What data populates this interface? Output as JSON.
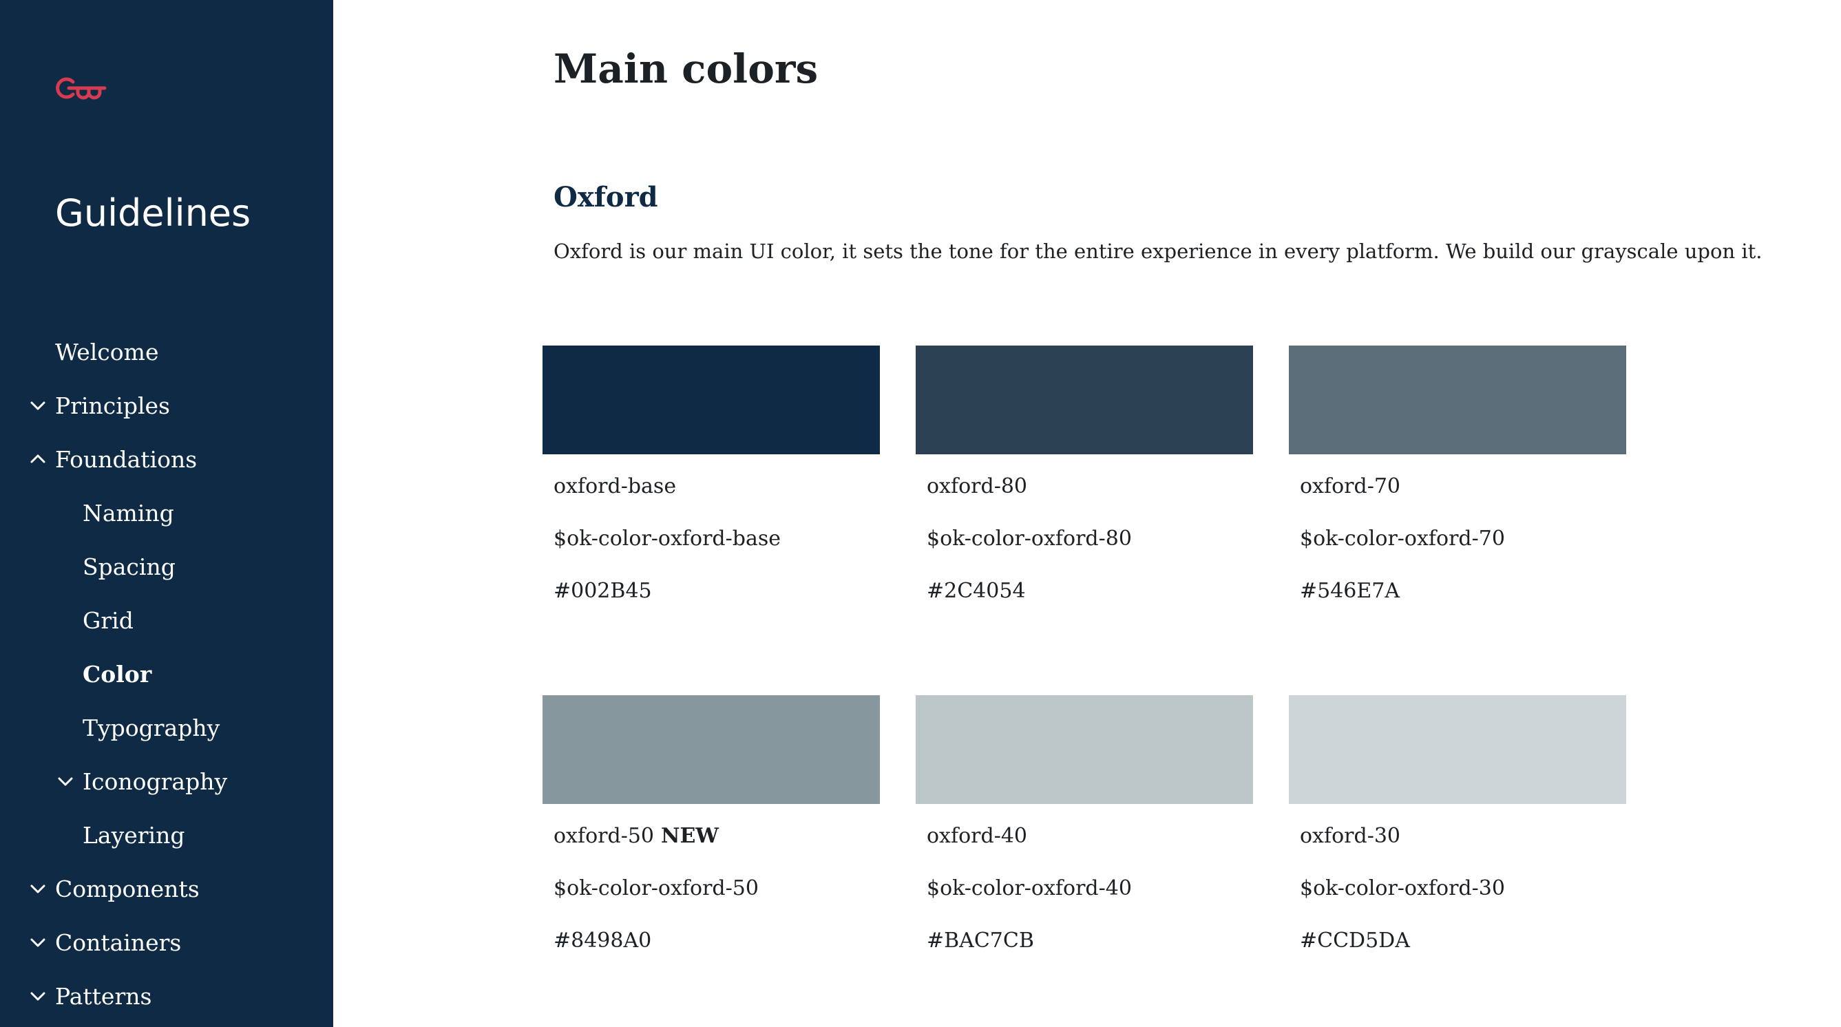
{
  "sidebar": {
    "brand": "Guidelines",
    "logo_color": "#d63b50",
    "background": "#0e2a45",
    "nav": [
      {
        "label": "Welcome",
        "level": 1,
        "chevron": "none",
        "active": false
      },
      {
        "label": "Principles",
        "level": 1,
        "chevron": "down",
        "active": false
      },
      {
        "label": "Foundations",
        "level": 1,
        "chevron": "up",
        "active": false
      },
      {
        "label": "Naming",
        "level": 2,
        "chevron": "none",
        "active": false
      },
      {
        "label": "Spacing",
        "level": 2,
        "chevron": "none",
        "active": false
      },
      {
        "label": "Grid",
        "level": 2,
        "chevron": "none",
        "active": false
      },
      {
        "label": "Color",
        "level": 2,
        "chevron": "none",
        "active": true
      },
      {
        "label": "Typography",
        "level": 2,
        "chevron": "none",
        "active": false
      },
      {
        "label": "Iconography",
        "level": 2,
        "chevron": "down",
        "active": false
      },
      {
        "label": "Layering",
        "level": 2,
        "chevron": "none",
        "active": false
      },
      {
        "label": "Components",
        "level": 1,
        "chevron": "down",
        "active": false
      },
      {
        "label": "Containers",
        "level": 1,
        "chevron": "down",
        "active": false
      },
      {
        "label": "Patterns",
        "level": 1,
        "chevron": "down",
        "active": false
      }
    ]
  },
  "main": {
    "title": "Main colors",
    "section": {
      "title": "Oxford",
      "description": "Oxford is our main UI color, it sets the tone for the entire experience in every platform. We build our grayscale upon it."
    },
    "swatches": [
      {
        "name": "oxford-base",
        "badge": "",
        "token": "$ok-color-oxford-base",
        "hex": "#002B45",
        "color": "#0e2a45"
      },
      {
        "name": "oxford-80",
        "badge": "",
        "token": "$ok-color-oxford-80",
        "hex": "#2C4054",
        "color": "#2c4054"
      },
      {
        "name": "oxford-70",
        "badge": "",
        "token": "$ok-color-oxford-70",
        "hex": "#546E7A",
        "color": "#5a6d79"
      },
      {
        "name": "oxford-50",
        "badge": "NEW",
        "token": "$ok-color-oxford-50",
        "hex": "#8498A0",
        "color": "#86979e"
      },
      {
        "name": "oxford-40",
        "badge": "",
        "token": "$ok-color-oxford-40",
        "hex": "#BAC7CB",
        "color": "#bcc6c8"
      },
      {
        "name": "oxford-30",
        "badge": "",
        "token": "$ok-color-oxford-30",
        "hex": "#CCD5DA",
        "color": "#ccd4d7"
      }
    ]
  }
}
